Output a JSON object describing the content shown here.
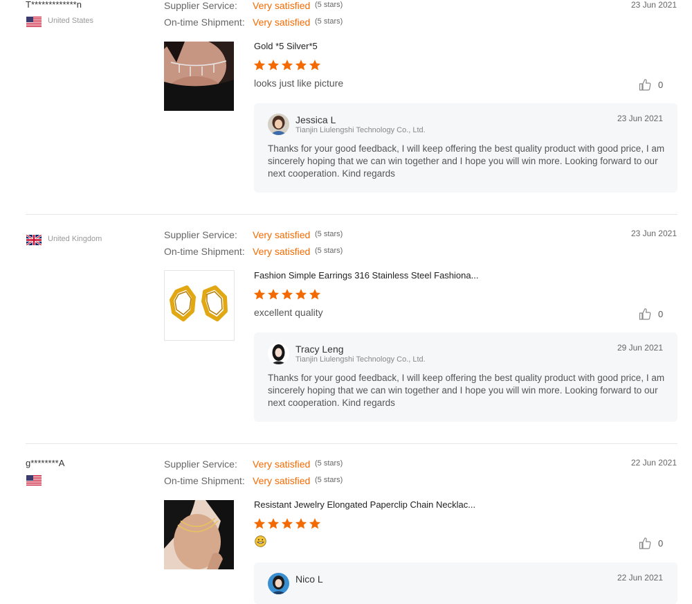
{
  "labels": {
    "supplier_service": "Supplier Service:",
    "on_time_shipment": "On-time Shipment:"
  },
  "reviews": [
    {
      "buyer": "T*************n",
      "country": "United States",
      "flag": "us-flag-icon",
      "supplier_rating": "Very satisfied",
      "supplier_stars": "(5 stars)",
      "shipment_rating": "Very satisfied",
      "shipment_stars": "(5 stars)",
      "date": "23 Jun 2021",
      "product_title": "Gold *5 Silver*5",
      "rating": 5,
      "comment": "looks just like picture",
      "likes": "0",
      "reply": {
        "name": "Jessica L",
        "company": "Tianjin Liulengshi Technology Co., Ltd.",
        "date": "23 Jun 2021",
        "text": "Thanks for your good feedback, I will keep offering the best quality product with good price, I am sincerely hoping that we can win together and I hope you will win more. Looking forward to our next cooperation. Kind regards"
      }
    },
    {
      "buyer": "",
      "country": "United Kingdom",
      "flag": "uk-flag-icon",
      "supplier_rating": "Very satisfied",
      "supplier_stars": "(5 stars)",
      "shipment_rating": "Very satisfied",
      "shipment_stars": "(5 stars)",
      "date": "23 Jun 2021",
      "product_title": "Fashion Simple Earrings 316 Stainless Steel Fashiona...",
      "rating": 5,
      "comment": "excellent quality",
      "likes": "0",
      "reply": {
        "name": "Tracy Leng",
        "company": "Tianjin Liulengshi Technology Co., Ltd.",
        "date": "29 Jun 2021",
        "text": "Thanks for your good feedback, I will keep offering the best quality product with good price, I am sincerely hoping that we can win together and I hope you will win more. Looking forward to our next cooperation. Kind regards"
      }
    },
    {
      "buyer": "g********A",
      "country": "",
      "flag": "us-flag-icon",
      "supplier_rating": "Very satisfied",
      "supplier_stars": "(5 stars)",
      "shipment_rating": "Very satisfied",
      "shipment_stars": "(5 stars)",
      "date": "22 Jun 2021",
      "product_title": "Resistant Jewelry Elongated Paperclip Chain Necklac...",
      "rating": 5,
      "comment_icon": "grinning-emoji-icon",
      "likes": "0",
      "reply": {
        "name": "Nico L",
        "company": "",
        "date": "22 Jun 2021",
        "text": ""
      }
    }
  ],
  "colors": {
    "accent_orange": "#f56a00",
    "reply_background": "#f6f7f9"
  }
}
